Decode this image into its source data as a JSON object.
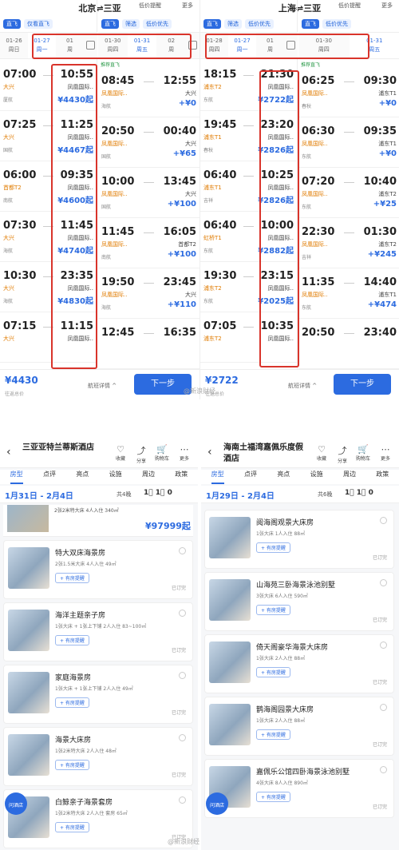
{
  "flight_left": {
    "route": "北京⇌三亚",
    "fav_label": "低价提醒",
    "more_label": "更多",
    "tags": [
      "直飞",
      "仅看直飞",
      "低价优先"
    ],
    "dates": [
      [
        "01-26",
        "周日"
      ],
      [
        "01-27",
        "周一"
      ],
      [
        "01",
        "周"
      ]
    ],
    "flights": [
      {
        "dep": "07:00",
        "dap": "大兴",
        "arr": "10:55",
        "aap": "凤凰国际..",
        "air": "厦航",
        "price": "¥4430起"
      },
      {
        "dep": "07:25",
        "dap": "大兴",
        "arr": "11:25",
        "aap": "凤凰国际..",
        "air": "国航",
        "price": "¥4467起"
      },
      {
        "dep": "06:00",
        "dap": "首都T2",
        "arr": "09:35",
        "aap": "凤凰国际..",
        "air": "南航",
        "price": "¥4600起"
      },
      {
        "dep": "07:30",
        "dap": "大兴",
        "arr": "11:45",
        "aap": "凤凰国际..",
        "air": "海航",
        "price": "¥4740起"
      },
      {
        "dep": "10:30",
        "dap": "大兴",
        "arr": "23:35",
        "aap": "凤凰国际..",
        "air": "海航",
        "price": "¥4830起"
      },
      {
        "dep": "07:15",
        "dap": "大兴",
        "arr": "11:15",
        "aap": "凤凰国际..",
        "air": "",
        "price": ""
      }
    ],
    "bottom_price": "¥4430",
    "bottom_sub": "往返总价",
    "detail": "航班详情 ^",
    "next": "下一步"
  },
  "flight_left_return": {
    "tags": [
      "直飞",
      "筛选",
      "低价优先"
    ],
    "dates": [
      [
        "01-30",
        "周四"
      ],
      [
        "01-31",
        "周五"
      ],
      [
        "02",
        "周"
      ]
    ],
    "flights": [
      {
        "dep": "08:45",
        "dap": "凤凰国际..",
        "arr": "12:55",
        "aap": "大兴",
        "air": "海航",
        "price": "+¥0"
      },
      {
        "dep": "20:50",
        "dap": "凤凰国际..",
        "arr": "00:40",
        "aap": "大兴",
        "air": "国航",
        "price": "+¥65"
      },
      {
        "dep": "10:00",
        "dap": "凤凰国际..",
        "arr": "13:45",
        "aap": "大兴",
        "air": "国航",
        "price": "+¥100"
      },
      {
        "dep": "11:45",
        "dap": "凤凰国际..",
        "arr": "16:05",
        "aap": "首都T2",
        "air": "南航",
        "price": "+¥100"
      },
      {
        "dep": "19:50",
        "dap": "凤凰国际..",
        "arr": "23:45",
        "aap": "大兴",
        "air": "海航",
        "price": "+¥110"
      },
      {
        "dep": "12:45",
        "dap": "",
        "arr": "16:35",
        "aap": "",
        "air": "",
        "price": ""
      }
    ],
    "top_label": "推荐直飞"
  },
  "flight_right": {
    "route": "上海⇌三亚",
    "fav_label": "低价提醒",
    "more_label": "更多",
    "tags": [
      "直飞",
      "筛选",
      "低价优先"
    ],
    "dates": [
      [
        "01-28",
        "周四"
      ],
      [
        "01-27",
        "周一"
      ],
      [
        "01",
        "周"
      ]
    ],
    "flights": [
      {
        "dep": "18:15",
        "dap": "浦东T2",
        "arr": "21:30",
        "aap": "凤凰国际..",
        "air": "东航",
        "price": "¥2722起"
      },
      {
        "dep": "19:45",
        "dap": "浦东T1",
        "arr": "23:20",
        "aap": "凤凰国际..",
        "air": "春秋",
        "price": "¥2826起"
      },
      {
        "dep": "06:40",
        "dap": "浦东T1",
        "arr": "10:25",
        "aap": "凤凰国际..",
        "air": "吉祥",
        "price": "¥2826起"
      },
      {
        "dep": "06:40",
        "dap": "虹桥T1",
        "arr": "10:00",
        "aap": "凤凰国际..",
        "air": "东航",
        "price": "¥2882起"
      },
      {
        "dep": "19:30",
        "dap": "浦东T2",
        "arr": "23:15",
        "aap": "凤凰国际..",
        "air": "东航",
        "price": "¥2025起"
      },
      {
        "dep": "07:05",
        "dap": "浦东T2",
        "arr": "10:35",
        "aap": "凤凰国际..",
        "air": "",
        "price": ""
      }
    ],
    "bottom_price": "¥2722",
    "bottom_sub": "往返总价",
    "detail": "航班详情 ^",
    "next": "下一步"
  },
  "flight_right_return": {
    "tags": [
      "直飞",
      "低价优先"
    ],
    "dates": [
      [
        "01-30",
        "周四"
      ],
      [
        "01-31",
        "周五"
      ]
    ],
    "flights": [
      {
        "dep": "06:25",
        "dap": "凤凰国际..",
        "arr": "09:30",
        "aap": "浦东T1",
        "air": "春秋",
        "price": "+¥0"
      },
      {
        "dep": "06:30",
        "dap": "凤凰国际..",
        "arr": "09:35",
        "aap": "浦东T1",
        "air": "东航",
        "price": "+¥0"
      },
      {
        "dep": "07:20",
        "dap": "凤凰国际..",
        "arr": "10:40",
        "aap": "浦东T2",
        "air": "东航",
        "price": "+¥25"
      },
      {
        "dep": "22:30",
        "dap": "凤凰国际..",
        "arr": "01:30",
        "aap": "浦东T2",
        "air": "吉祥",
        "price": "+¥245"
      },
      {
        "dep": "11:35",
        "dap": "凤凰国际..",
        "arr": "14:40",
        "aap": "浦东T1",
        "air": "东航",
        "price": "+¥474"
      },
      {
        "dep": "20:50",
        "dap": "",
        "arr": "23:40",
        "aap": "",
        "air": "",
        "price": ""
      }
    ],
    "top_label": "推荐直飞"
  },
  "watermark_top": "@新浪财经",
  "watermark_bottom": "@新浪财经",
  "hotel_left": {
    "title": "三亚亚特兰蒂斯酒店",
    "icons": [
      [
        "♡",
        "收藏"
      ],
      [
        "⤴",
        "分享"
      ],
      [
        "🛒",
        "购物车"
      ],
      [
        "⋯",
        "更多"
      ]
    ],
    "tabs": [
      "房型",
      "点评",
      "亮点",
      "设施",
      "周边",
      "政策"
    ],
    "date": "1月31日 - 2月4日",
    "nights": "共4晚",
    "people": "1⃣ 1⃣ 0",
    "top_spec": "2张2米特大床 4人入住 340㎡",
    "top_price": "¥97999起",
    "rooms": [
      {
        "name": "特大双床海景房",
        "spec": "2张1.5米大床 4人入住 49㎡",
        "btn": "+ 有房提醒",
        "status": "已订完"
      },
      {
        "name": "海洋主题亲子房",
        "spec": "1张大床 + 1张上下铺 2人入住 83~100㎡",
        "btn": "+ 有房提醒",
        "status": "已订完"
      },
      {
        "name": "家庭海景房",
        "spec": "1张大床 + 1张上下铺 2人入住 49㎡",
        "btn": "+ 有房提醒",
        "status": "已订完"
      },
      {
        "name": "海景大床房",
        "spec": "1张2米特大床 2人入住 48㎡",
        "btn": "+ 有房提醒",
        "status": "已订完"
      },
      {
        "name": "白鲸亲子海景套房",
        "spec": "1张2米特大床 2人入住 套房 65㎡",
        "btn": "+ 有房提醒",
        "status": "已订完"
      }
    ],
    "float": "问酒店"
  },
  "hotel_right": {
    "title": "海南土福湾嘉佩乐度假酒店",
    "icons": [
      [
        "♡",
        "收藏"
      ],
      [
        "⤴",
        "分享"
      ],
      [
        "🛒",
        "购物车"
      ],
      [
        "⋯",
        "更多"
      ]
    ],
    "tabs": [
      "房型",
      "点评",
      "亮点",
      "设施",
      "周边",
      "政策"
    ],
    "date": "1月29日 - 2月4日",
    "nights": "共6晚",
    "people": "1⃣ 1⃣ 0",
    "rooms": [
      {
        "name": "阅海阁观景大床房",
        "spec": "1张大床 1人入住 88㎡",
        "btn": "+ 有房提醒",
        "status": "已订完"
      },
      {
        "name": "山海苑三卧海景泳池别墅",
        "spec": "3张大床 6人入住 590㎡",
        "btn": "+ 有房提醒",
        "status": "已订完"
      },
      {
        "name": "倚天阁豪华海景大床房",
        "spec": "1张大床 2人入住 88㎡",
        "btn": "+ 有房提醒",
        "status": "已订完"
      },
      {
        "name": "鹊海阁园景大床房",
        "spec": "1张大床 2人入住 88㎡",
        "btn": "+ 有房提醒",
        "status": "已订完"
      },
      {
        "name": "嘉佩乐公馆四卧海景泳池别墅",
        "spec": "4张大床 8人入住 890㎡",
        "btn": "+ 有房提醒",
        "status": "已订完"
      }
    ],
    "float": "问酒店"
  }
}
